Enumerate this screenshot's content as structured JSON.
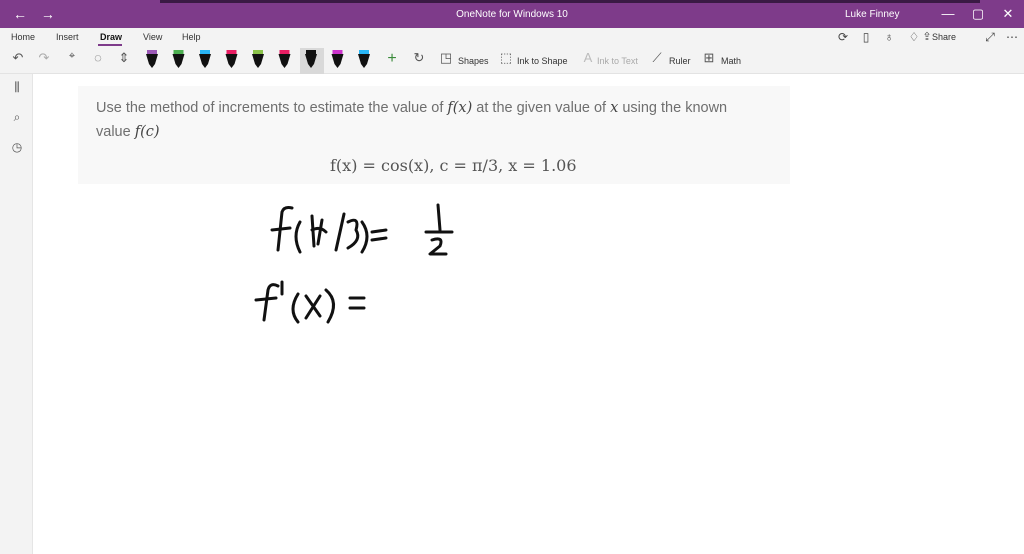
{
  "window": {
    "title": "OneNote for Windows 10",
    "user": "Luke Finney",
    "back_glyph": "←",
    "forward_glyph": "→",
    "minimize_glyph": "—",
    "maximize_glyph": "▢",
    "close_glyph": "✕"
  },
  "menu": {
    "items": [
      "Home",
      "Insert",
      "Draw",
      "View",
      "Help"
    ],
    "active": "Draw",
    "share_label": "Share",
    "more_glyph": "⋯"
  },
  "toolbar": {
    "shapes_label": "Shapes",
    "ink_to_shape_label": "Ink to Shape",
    "ink_to_text_label": "Ink to Text",
    "ruler_label": "Ruler",
    "math_label": "Math",
    "add_pen_glyph": "+"
  },
  "pens": [
    {
      "color": "#9b59b6"
    },
    {
      "color": "#4caf50"
    },
    {
      "color": "#29b6f6"
    },
    {
      "color": "#e91e63"
    },
    {
      "color": "#8bc34a"
    },
    {
      "color": "#e91e63"
    },
    {
      "color": "#111111"
    },
    {
      "color": "#cc33cc"
    },
    {
      "color": "#29b6f6"
    }
  ],
  "question": {
    "line1_pre": "Use the method of increments to estimate the value of ",
    "line1_fx": "f(x)",
    "line1_mid": " at the given value of ",
    "line1_x": "x",
    "line1_post": " using the known",
    "line2_pre": "value ",
    "line2_fc": "f(c)",
    "formula": "f(x) = cos(x), c = π/3, x = 1.06"
  },
  "handwriting": {
    "line1_left": "f(π/3)=",
    "line1_right": "1/2",
    "line2": "f'(x) ="
  },
  "colors": {
    "titlebar": "#7e3b8a",
    "accent": "#7e3b8a"
  }
}
